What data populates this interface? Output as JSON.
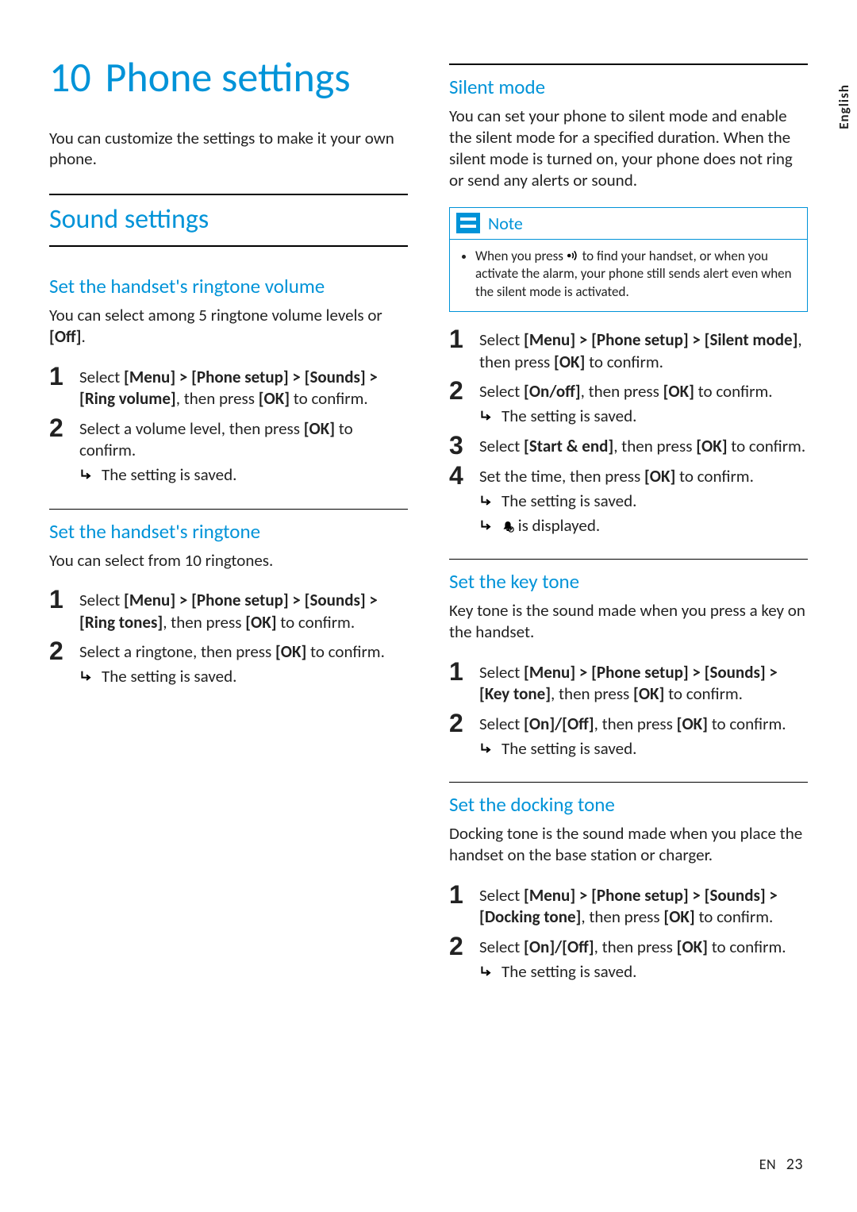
{
  "lang_tab": "English",
  "chapter": {
    "num": "10",
    "title": "Phone settings"
  },
  "intro": "You can customize the settings to make it your own phone.",
  "section_sound": "Sound settings",
  "ringtone_volume": {
    "heading": "Set the handset's ringtone volume",
    "intro_a": "You can select among 5 ringtone volume levels or ",
    "intro_off": "[Off]",
    "intro_b": ".",
    "steps": [
      {
        "n": "1",
        "pre": "Select ",
        "path": "[Menu] > [Phone setup] > [Sounds] > [Ring volume]",
        "post": ", then press ",
        "ok": "[OK]",
        "tail": " to confirm."
      },
      {
        "n": "2",
        "pre": "Select a volume level, then press ",
        "path": "",
        "post": "",
        "ok": "[OK]",
        "tail": " to confirm."
      }
    ],
    "result": "The setting is saved."
  },
  "ringtone": {
    "heading": "Set the handset's ringtone",
    "intro": "You can select from 10 ringtones.",
    "steps": [
      {
        "n": "1",
        "pre": "Select ",
        "path": "[Menu] > [Phone setup] > [Sounds] > [Ring tones]",
        "post": ", then press ",
        "ok": "[OK]",
        "tail": " to confirm."
      },
      {
        "n": "2",
        "pre": "Select a ringtone, then press ",
        "path": "",
        "post": "",
        "ok": "[OK]",
        "tail": " to confirm."
      }
    ],
    "result": "The setting is saved."
  },
  "silent": {
    "heading": "Silent mode",
    "intro": "You can set your phone to silent mode and enable the silent mode for a specified duration. When the silent mode is turned on, your phone does not ring or send any alerts or sound.",
    "note_label": "Note",
    "note_a": "When you press ",
    "note_b": " to find your handset, or when you activate the alarm, your phone still sends alert even when the silent mode is activated.",
    "steps": [
      {
        "n": "1",
        "pre": "Select ",
        "path": "[Menu] > [Phone setup] > [Silent mode]",
        "post": ", then press ",
        "ok": "[OK]",
        "tail": " to confirm."
      },
      {
        "n": "2",
        "pre": "Select ",
        "path": "[On/off]",
        "post": ", then press ",
        "ok": "[OK]",
        "tail": " to confirm.",
        "result": "The setting is saved."
      },
      {
        "n": "3",
        "pre": "Select ",
        "path": "[Start & end]",
        "post": ", then press ",
        "ok": "[OK]",
        "tail": " to confirm."
      },
      {
        "n": "4",
        "pre": "Set the time, then press ",
        "path": "",
        "post": "",
        "ok": "[OK]",
        "tail": " to confirm.",
        "result": "The setting is saved.",
        "result2": " is displayed."
      }
    ]
  },
  "keytone": {
    "heading": "Set the key tone",
    "intro": "Key tone is the sound made when you press a key on the handset.",
    "steps": [
      {
        "n": "1",
        "pre": "Select ",
        "path": "[Menu] > [Phone setup] > [Sounds] > [Key tone]",
        "post": ", then press ",
        "ok": "[OK]",
        "tail": " to confirm."
      },
      {
        "n": "2",
        "pre": "Select ",
        "path": "[On]/[Off]",
        "post": ", then press ",
        "ok": "[OK]",
        "tail": " to confirm.",
        "result": "The setting is saved."
      }
    ]
  },
  "docking": {
    "heading": "Set the docking tone",
    "intro": "Docking tone is the sound made when you place the handset on the base station or charger.",
    "steps": [
      {
        "n": "1",
        "pre": "Select ",
        "path": "[Menu] > [Phone setup] > [Sounds] > [Docking tone]",
        "post": ", then press ",
        "ok": "[OK]",
        "tail": " to confirm."
      },
      {
        "n": "2",
        "pre": "Select ",
        "path": "[On]/[Off]",
        "post": ", then press ",
        "ok": "[OK]",
        "tail": " to confirm.",
        "result": "The setting is saved."
      }
    ]
  },
  "footer": {
    "lang": "EN",
    "page": "23"
  }
}
